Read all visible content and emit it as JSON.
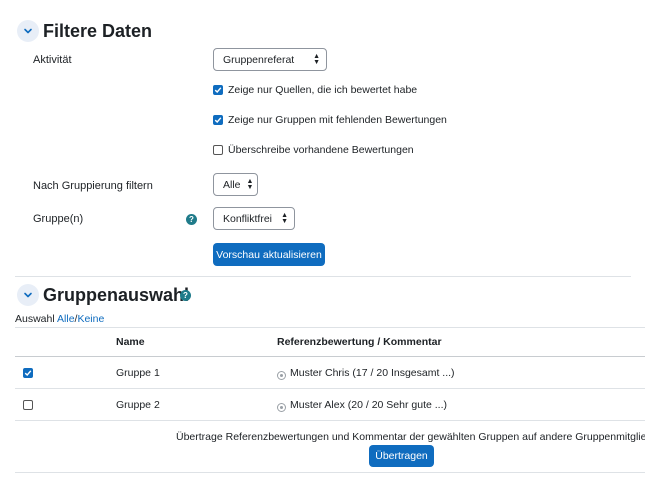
{
  "filter": {
    "title": "Filtere Daten",
    "activity_label": "Aktivität",
    "activity_value": "Gruppenreferat",
    "checkboxes": [
      {
        "label": "Zeige nur Quellen, die ich bewertet habe",
        "checked": true
      },
      {
        "label": "Zeige nur Gruppen mit fehlenden Bewertungen",
        "checked": true
      },
      {
        "label": "Überschreibe vorhandene Bewertungen",
        "checked": false
      }
    ],
    "grouping_label": "Nach Gruppierung filtern",
    "grouping_value": "Alle",
    "group_label": "Gruppe(n)",
    "group_value": "Konfliktfrei",
    "help_glyph": "?",
    "refresh_button": "Vorschau aktualisieren"
  },
  "selection": {
    "title": "Gruppenauswahl",
    "help_glyph": "?",
    "select_prefix": "Auswahl ",
    "select_all": "Alle",
    "select_sep": "/",
    "select_none": "Keine",
    "col_name": "Name",
    "col_ref": "Referenzbewertung / Kommentar",
    "rows": [
      {
        "checked": true,
        "name": "Gruppe 1",
        "ref": "Muster Chris (17 / 20 Insgesamt ...)"
      },
      {
        "checked": false,
        "name": "Gruppe 2",
        "ref": "Muster Alex (20 / 20 Sehr gute ...)"
      }
    ],
    "transfer_text": "Übertrage Referenzbewertungen und Kommentar der gewählten Gruppen auf andere Gruppenmitglieder",
    "transfer_button": "Übertragen"
  },
  "colors": {
    "primary": "#0f6cbf",
    "help": "#1f7b8a"
  }
}
